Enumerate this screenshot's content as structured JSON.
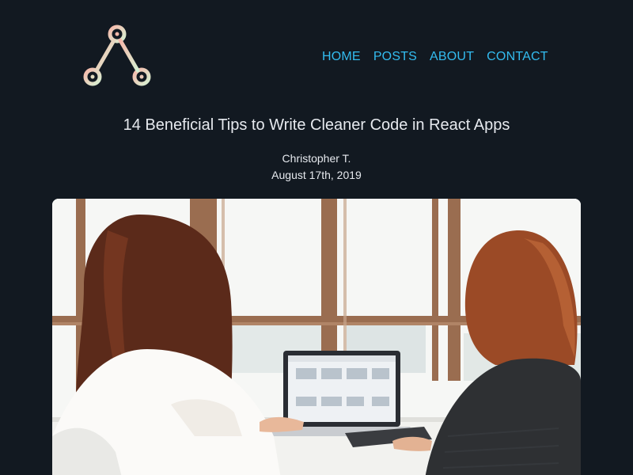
{
  "header": {
    "logo_icon": "triangle-nodes-logo",
    "nav": [
      {
        "label": "HOME"
      },
      {
        "label": "POSTS"
      },
      {
        "label": "ABOUT"
      },
      {
        "label": "CONTACT"
      }
    ]
  },
  "post": {
    "title": "14 Beneficial Tips to Write Cleaner Code in React Apps",
    "author": "Christopher T.",
    "date": "August 17th, 2019",
    "hero_image": "photo-two-women-at-laptop"
  },
  "colors": {
    "background": "#121921",
    "nav_link": "#33bcf0",
    "text": "#e6e9ee",
    "logo_gradient_start": "#f6b8aa",
    "logo_gradient_end": "#d6f0d2"
  }
}
